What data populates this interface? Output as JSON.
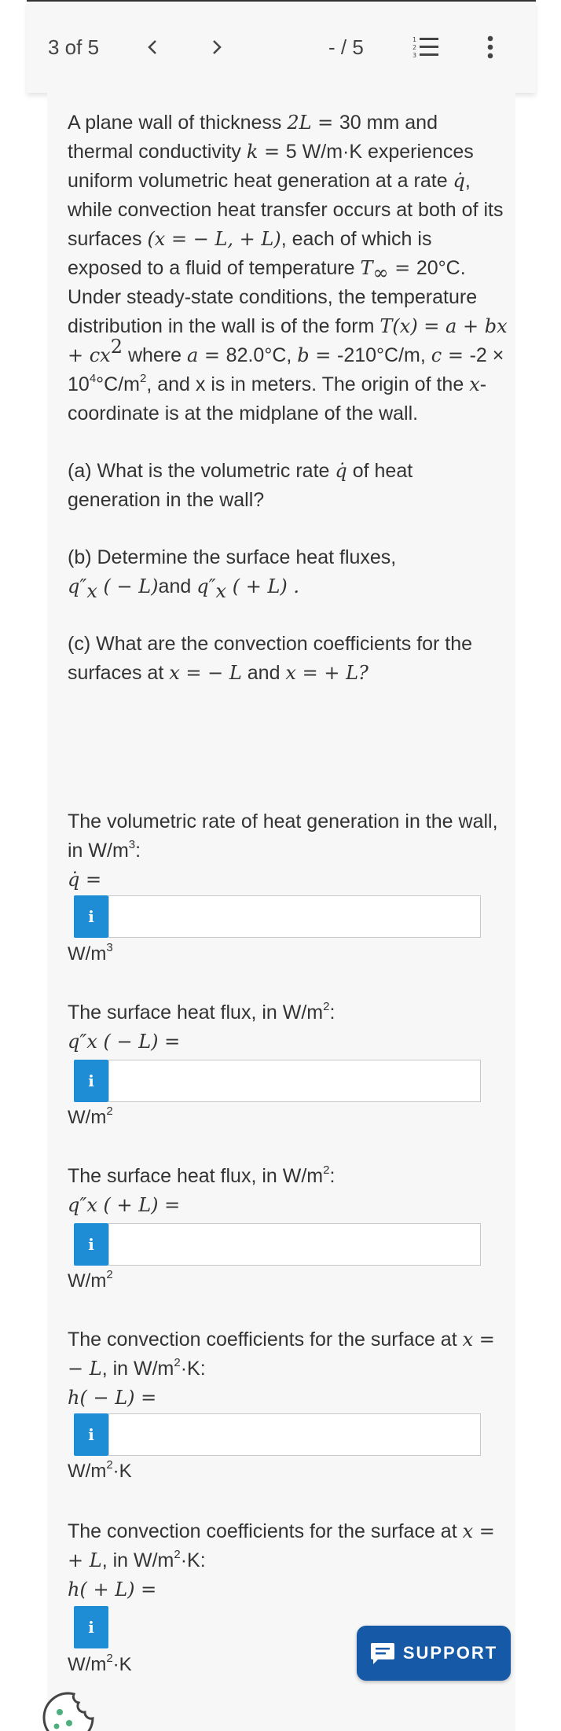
{
  "toolbar": {
    "counter": "3 of 5",
    "prev_icon": "chevron-left-icon",
    "next_icon": "chevron-right-icon",
    "score": "- / 5",
    "list_icon": "numbered-list-icon",
    "more_icon": "more-vertical-icon"
  },
  "problem": {
    "p1": "A plane wall of thickness ",
    "thick_math": "2L = ",
    "thick_val": " 30 mm and thermal conductivity ",
    "k_math": "k = ",
    "k_val": " 5 W/m·K experiences uniform volumetric heat generation at a rate ",
    "qdot": "q̇",
    "p2": ", while convection heat transfer occurs at both of its surfaces ",
    "surfaces_math": "(x = − L,  + L)",
    "p3": ", each of which is exposed to a fluid of temperature ",
    "tinf_math": "T",
    "tinf_sub": "∞",
    "tinf_eq": " = ",
    "tinf_val": " 20°C. Under steady-state conditions, the temperature distribution in the wall is of the form ",
    "tx_math": "T(x) = a + bx + cx",
    "tx_sup": "2",
    "p4": " where ",
    "a_math": "a = ",
    "a_val": " 82.0°C, ",
    "b_math": "b = ",
    "b_val": " -210°C/m, ",
    "c_math": "c = ",
    "c_val": " -2 × 10",
    "c_sup": "4",
    "c_unit": "°C/m",
    "c_unit_sup": "2",
    "p5": ", and x is in meters. The origin of the ",
    "x_math": "x",
    "p6": "-coordinate is at the midplane of the wall."
  },
  "questions": {
    "a_text": "(a) What is the volumetric rate ",
    "a_qdot": "q̇",
    "a_rest": " of heat generation in the wall?",
    "b_text": "(b) Determine the surface heat fluxes,",
    "b_m1": "q″",
    "b_m1_sub": "x",
    "b_m1_arg": " ( − L)",
    "b_and": "and ",
    "b_m2": "q″",
    "b_m2_sub": "x",
    "b_m2_arg": " ( + L) .",
    "c_text": "(c) What are the convection coefficients for the surfaces at ",
    "c_m1": "x = − L",
    "c_and": " and ",
    "c_m2": "x = + L?"
  },
  "answers": [
    {
      "label": "The volumetric rate of heat generation in the wall, in W/m",
      "label_sup": "3",
      "label_end": ":",
      "math": "q̇ =",
      "unit": "W/m",
      "unit_sup": "3",
      "unit_end": "",
      "value": ""
    },
    {
      "label": "The surface heat flux, in W/m",
      "label_sup": "2",
      "label_end": ":",
      "math": "q″x ( − L) =",
      "unit": "W/m",
      "unit_sup": "2",
      "unit_end": "",
      "value": ""
    },
    {
      "label": "The surface heat flux, in W/m",
      "label_sup": "2",
      "label_end": ":",
      "math": "q″x ( + L) =",
      "unit": "W/m",
      "unit_sup": "2",
      "unit_end": "",
      "value": ""
    },
    {
      "label": "The convection coefficients for the surface at ",
      "label_math": "x = − L",
      "label_tail": ", in W/m",
      "label_sup": "2",
      "label_end": "·K:",
      "math": "h( − L) =",
      "unit": "W/m",
      "unit_sup": "2",
      "unit_end": "·K",
      "value": ""
    },
    {
      "label": "The convection coefficients for the surface at ",
      "label_math": "x = + L",
      "label_tail": ", in W/m",
      "label_sup": "2",
      "label_end": "·K:",
      "math": "h( + L) =",
      "unit": "W/m",
      "unit_sup": "2",
      "unit_end": "·K",
      "value": ""
    }
  ],
  "info_icon_label": "i",
  "support": {
    "label": "SUPPORT",
    "icon": "chat-icon"
  },
  "cookie_icon": "cookie-icon",
  "colors": {
    "accent": "#1f8dd6",
    "support_bg": "#1659a6",
    "panel_bg": "#f7f7f7"
  }
}
